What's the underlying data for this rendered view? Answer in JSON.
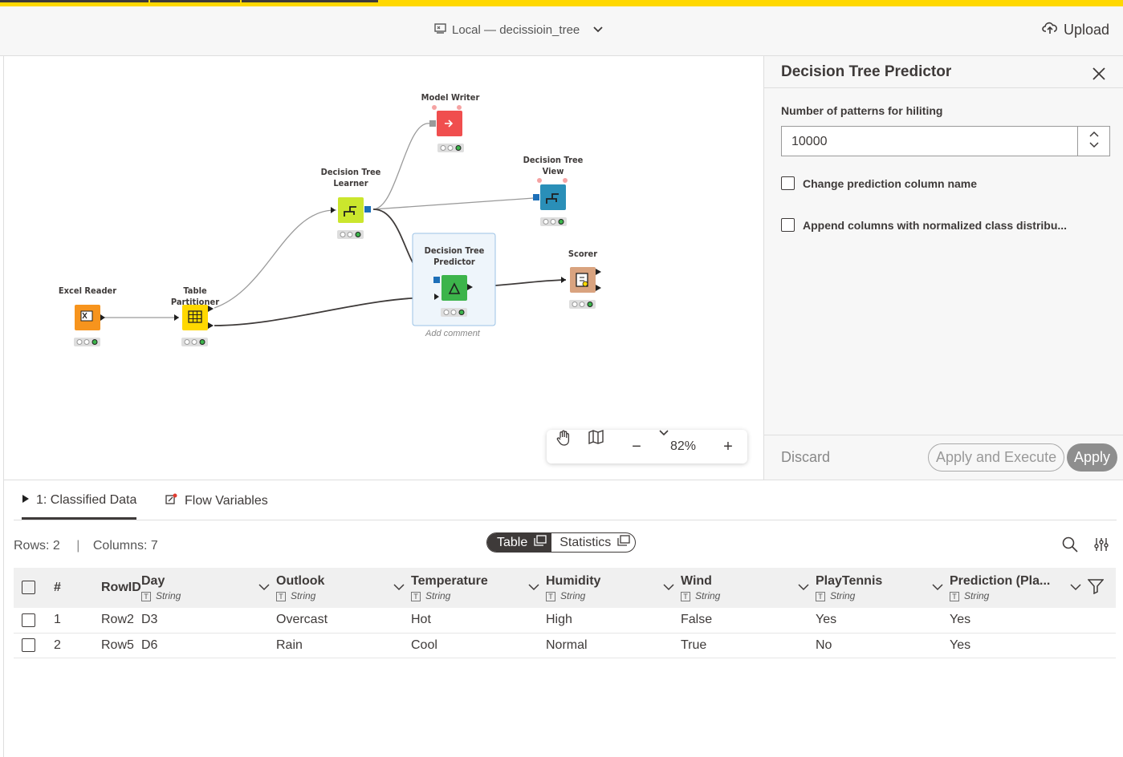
{
  "header": {
    "project_label": "Local — decissioin_tree",
    "upload_label": "Upload"
  },
  "workflow": {
    "nodes": [
      {
        "id": "excel-reader",
        "label": "Excel Reader",
        "color": "#f7941d"
      },
      {
        "id": "table-partitioner",
        "label": "Table Partitioner",
        "color": "#ffd800"
      },
      {
        "id": "dt-learner",
        "label": "Decision Tree Learner",
        "color": "#cbe62d"
      },
      {
        "id": "model-writer",
        "label": "Model Writer",
        "color": "#f04e4e"
      },
      {
        "id": "dt-view",
        "label": "Decision Tree View",
        "color": "#1d9bd1"
      },
      {
        "id": "dt-predictor",
        "label": "Decision Tree Predictor",
        "color": "#3cb44b"
      },
      {
        "id": "scorer",
        "label": "Scorer",
        "color": "#d9a37f"
      }
    ],
    "add_comment": "Add comment",
    "zoom_level": "82%"
  },
  "side_panel": {
    "title": "Decision Tree Predictor",
    "patterns_label": "Number of patterns for hiliting",
    "patterns_value": "10000",
    "change_prediction_label": "Change prediction column name",
    "append_columns_label": "Append columns with normalized class distribu...",
    "discard_label": "Discard",
    "apply_execute_label": "Apply and Execute",
    "apply_label": "Apply"
  },
  "output": {
    "tabs": [
      {
        "label": "1: Classified Data"
      },
      {
        "label": "Flow Variables"
      }
    ],
    "rows_label": "Rows: 2",
    "columns_label": "Columns: 7",
    "view_table": "Table",
    "view_statistics": "Statistics",
    "headers": {
      "index": "#",
      "rowid": "RowID",
      "columns": [
        {
          "name": "Day",
          "type": "String"
        },
        {
          "name": "Outlook",
          "type": "String"
        },
        {
          "name": "Temperature",
          "type": "String"
        },
        {
          "name": "Humidity",
          "type": "String"
        },
        {
          "name": "Wind",
          "type": "String"
        },
        {
          "name": "PlayTennis",
          "type": "String"
        },
        {
          "name": "Prediction (Pla...",
          "type": "String"
        }
      ]
    },
    "rows": [
      {
        "index": "1",
        "rowid": "Row2",
        "cells": [
          "D3",
          "Overcast",
          "Hot",
          "High",
          "False",
          "Yes",
          "Yes"
        ]
      },
      {
        "index": "2",
        "rowid": "Row5",
        "cells": [
          "D6",
          "Rain",
          "Cool",
          "Normal",
          "True",
          "No",
          "Yes"
        ]
      }
    ]
  }
}
